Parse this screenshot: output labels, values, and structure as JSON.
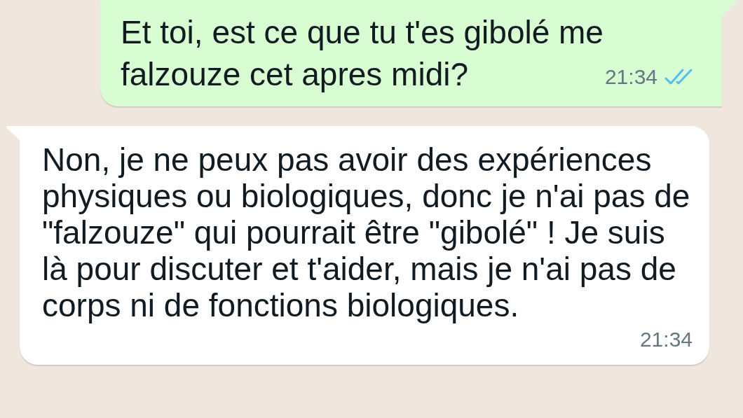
{
  "messages": [
    {
      "kind": "sent",
      "text": "Et toi, est ce que tu t'es gibolé me falzouze cet apres midi?",
      "time": "21:34",
      "read": true
    },
    {
      "kind": "received",
      "text": "Non, je ne peux pas avoir des expériences physiques ou biologiques, donc je n'ai pas de \"falzouze\" qui pourrait être \"gibolé\" ! Je suis là pour discuter et t'aider, mais je n'ai pas de corps ni de fonctions biologiques.",
      "time": "21:34"
    }
  ]
}
